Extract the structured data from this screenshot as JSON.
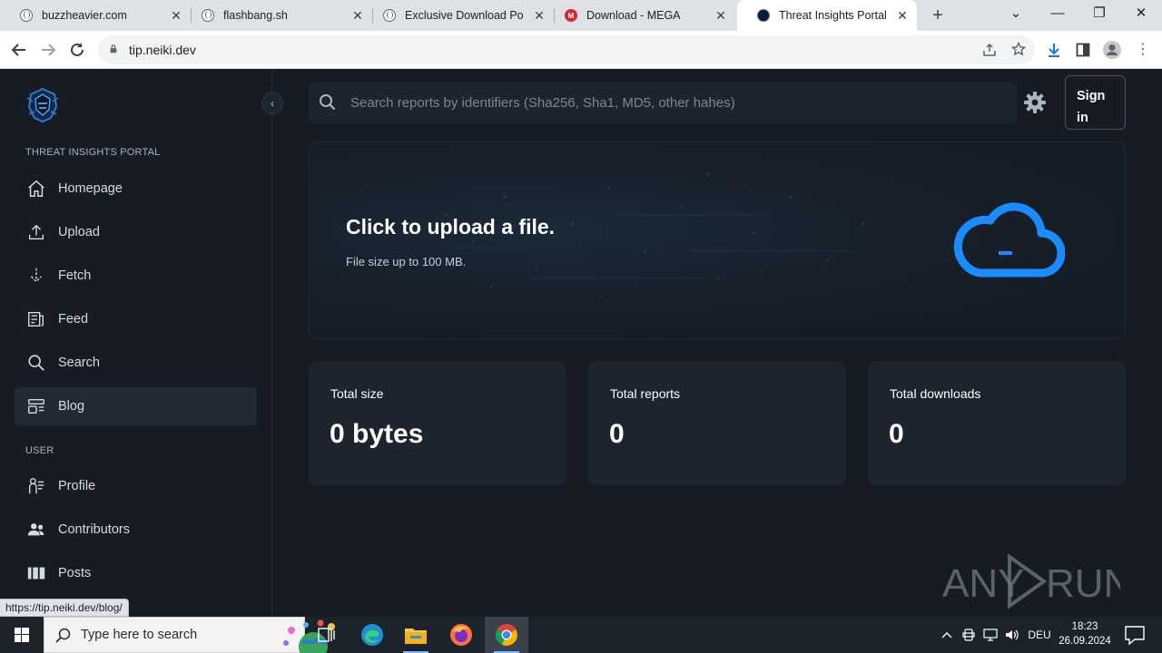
{
  "browser": {
    "tabs": [
      {
        "title": "buzzheavier.com",
        "favicon": "globe-icon"
      },
      {
        "title": "flashbang.sh",
        "favicon": "globe-icon"
      },
      {
        "title": "Exclusive Download Port",
        "favicon": "globe-icon"
      },
      {
        "title": "Download - MEGA",
        "favicon": "mega-icon"
      },
      {
        "title": "Threat Insights Portal",
        "favicon": "tip-icon",
        "active": true
      }
    ],
    "url": "tip.neiki.dev",
    "status_url": "https://tip.neiki.dev/blog/"
  },
  "sidebar": {
    "section_main": "THREAT INSIGHTS PORTAL",
    "items": [
      {
        "label": "Homepage",
        "icon": "home-icon"
      },
      {
        "label": "Upload",
        "icon": "upload-icon"
      },
      {
        "label": "Fetch",
        "icon": "fetch-icon"
      },
      {
        "label": "Feed",
        "icon": "feed-icon"
      },
      {
        "label": "Search",
        "icon": "search-icon"
      },
      {
        "label": "Blog",
        "icon": "blog-icon",
        "active": true
      }
    ],
    "section_user": "USER",
    "user_items": [
      {
        "label": "Profile",
        "icon": "profile-icon"
      },
      {
        "label": "Contributors",
        "icon": "contributors-icon"
      },
      {
        "label": "Posts",
        "icon": "posts-icon"
      }
    ]
  },
  "header": {
    "search_placeholder": "Search reports by identifiers (Sha256, Sha1, MD5, other hahes)",
    "sign_in": "Sign in"
  },
  "upload": {
    "title": "Click to upload a file.",
    "subtitle": "File size up to 100 MB."
  },
  "stats": [
    {
      "label": "Total size",
      "value": "0 bytes"
    },
    {
      "label": "Total reports",
      "value": "0"
    },
    {
      "label": "Total downloads",
      "value": "0"
    }
  ],
  "watermark": "ANY RUN",
  "taskbar": {
    "search_placeholder": "Type here to search",
    "language": "DEU",
    "time": "18:23",
    "date": "26.09.2024"
  },
  "colors": {
    "accent": "#1a8cff",
    "background": "#161b24",
    "card": "#1e242e"
  }
}
